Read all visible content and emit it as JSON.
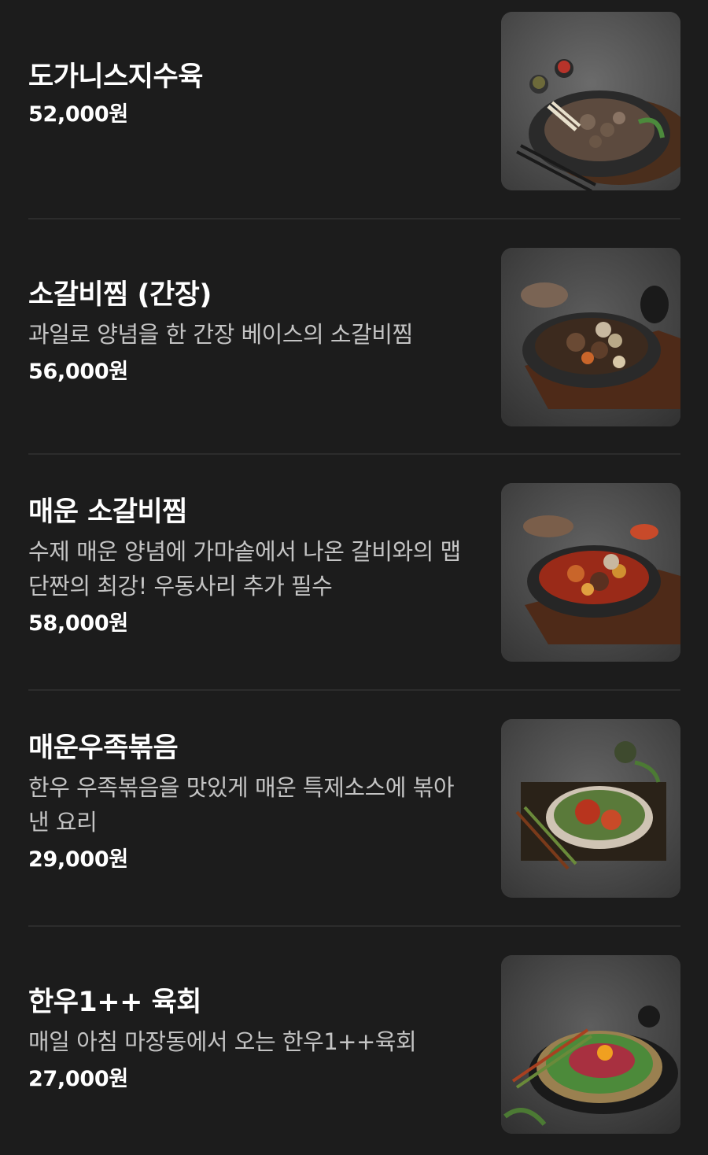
{
  "menu": {
    "items": [
      {
        "name": "도가니스지수육",
        "description": "",
        "price": "52,000원",
        "photo_icon": "braised-beef-platter-photo"
      },
      {
        "name": "소갈비찜 (간장)",
        "description": "과일로 양념을 한 간장 베이스의 소갈비찜",
        "price": "56,000원",
        "photo_icon": "soy-braised-short-ribs-photo"
      },
      {
        "name": "매운 소갈비찜",
        "description": "수제 매운 양념에 가마솥에서 나온 갈비와의 맵단짠의 최강! 우동사리 추가 필수",
        "price": "58,000원",
        "photo_icon": "spicy-braised-short-ribs-photo"
      },
      {
        "name": "매운우족볶음",
        "description": "한우 우족볶음을 맛있게 매운 특제소스에 볶아낸 요리",
        "price": "29,000원",
        "photo_icon": "spicy-ox-feet-stir-fry-photo"
      },
      {
        "name": "한우1++ 육회",
        "description": "매일 아침 마장동에서 오는 한우1++육회",
        "price": "27,000원",
        "photo_icon": "beef-tartare-photo"
      }
    ]
  },
  "colors": {
    "background": "#1c1c1c",
    "divider": "#2c2c2c",
    "name_text": "#ffffff",
    "desc_text": "#c4c4c4"
  }
}
